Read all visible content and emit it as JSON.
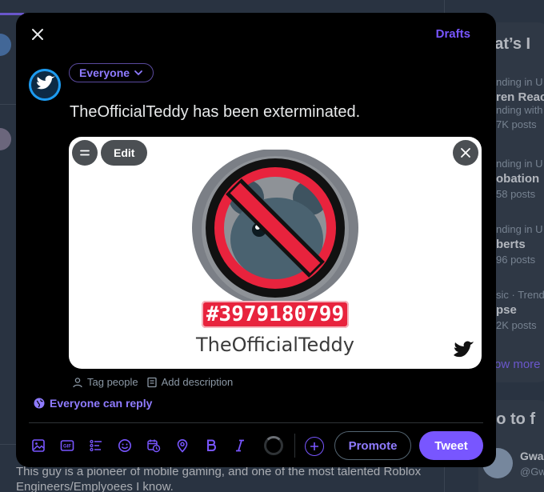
{
  "background": {
    "trends_title": "hat’s I",
    "trends": [
      {
        "context": "nding in U",
        "name": "ren Reac",
        "posts": "nding with"
      },
      {
        "context": "nding in U",
        "name": "obation",
        "posts": "58 posts"
      },
      {
        "context": "nding in U",
        "name": "berts",
        "posts": "96 posts"
      },
      {
        "context": "sic · Trend",
        "name": "pse",
        "posts": "2K posts"
      }
    ],
    "first_trend_posts": "7K posts",
    "show_more": "ow more",
    "who_to_follow": "ho to f",
    "who_name": "Gwa",
    "who_handle": "@Gw",
    "underlying_tweet": "This guy is a pioneer of mobile gaming, and one of the most talented Roblox Engineers/Emplyoees I know."
  },
  "composer": {
    "drafts_label": "Drafts",
    "audience_label": "Everyone",
    "tweet_text": "TheOfficialTeddy has been exterminated.",
    "media": {
      "edit_label": "Edit",
      "badge_number": "#3979180799",
      "username": "TheOfficialTeddy"
    },
    "tag_people_label": "Tag people",
    "add_description_label": "Add description",
    "reply_setting_label": "Everyone can reply",
    "promote_label": "Promote",
    "tweet_label": "Tweet",
    "gif_label": "GIF"
  },
  "colors": {
    "accent": "#7856ff",
    "modal_bg": "#000000",
    "page_bg": "#15202b",
    "ban_red": "#e8233d"
  },
  "icons": [
    "close-icon",
    "chevron-down-icon",
    "twitter-bird-icon",
    "menu-icon",
    "person-icon",
    "description-icon",
    "globe-icon",
    "image-icon",
    "gif-icon",
    "poll-icon",
    "emoji-icon",
    "schedule-icon",
    "location-icon",
    "bold-icon",
    "italic-icon",
    "plus-icon"
  ]
}
